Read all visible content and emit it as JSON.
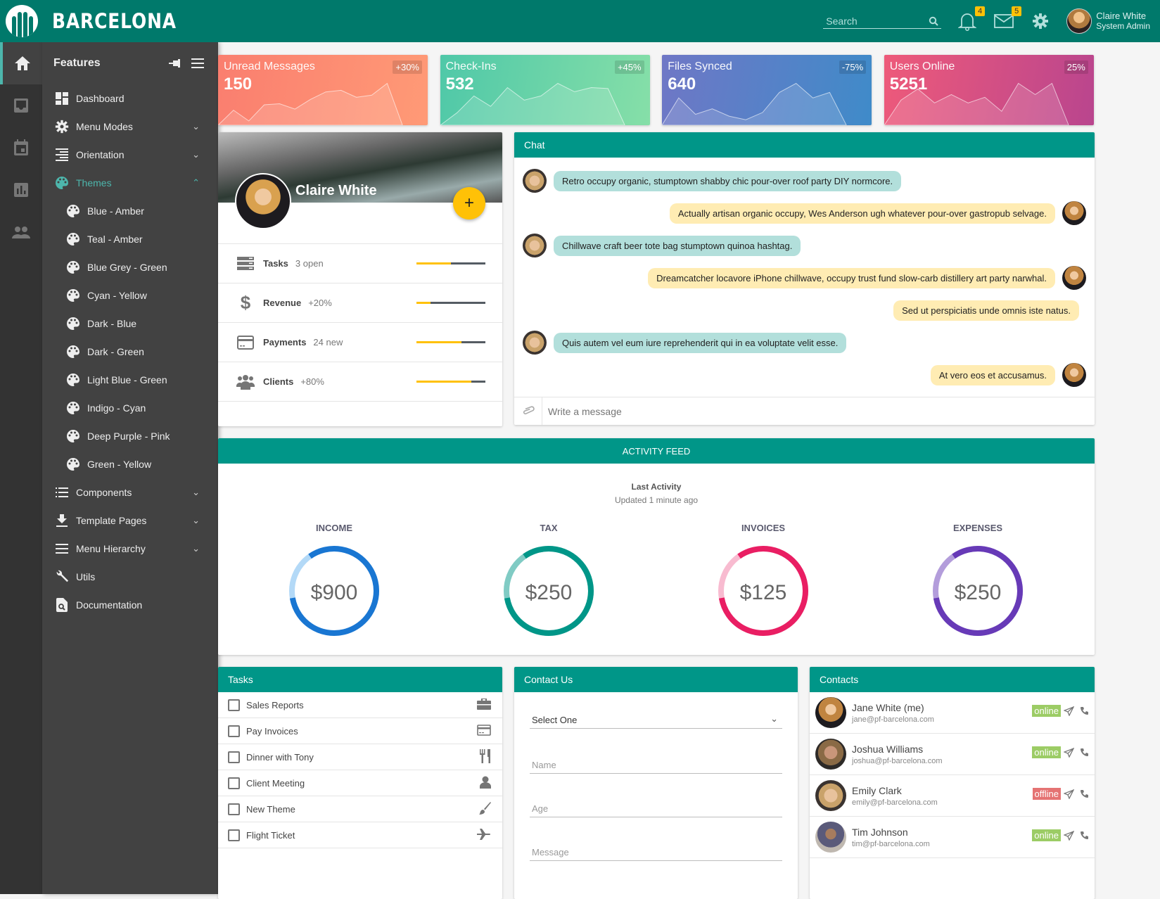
{
  "brand": {
    "name": "BARCELONA"
  },
  "topbar": {
    "search_placeholder": "Search",
    "notifications": {
      "icon": "bell-icon",
      "count": "4"
    },
    "messages": {
      "icon": "envelope-icon",
      "count": "5"
    },
    "settings_icon": "gear-icon",
    "user": {
      "name": "Claire White",
      "role": "System Admin"
    }
  },
  "rail": [
    "home-icon",
    "inbox-icon",
    "calendar-icon",
    "chart-icon",
    "people-icon"
  ],
  "menu": {
    "title": "Features",
    "items": [
      {
        "label": "Dashboard",
        "icon": "dashboard-icon",
        "expandable": false
      },
      {
        "label": "Menu Modes",
        "icon": "gear-icon",
        "expandable": true
      },
      {
        "label": "Orientation",
        "icon": "align-right-icon",
        "expandable": true
      },
      {
        "label": "Themes",
        "icon": "palette-icon",
        "expandable": true,
        "expanded": true,
        "active": true
      },
      {
        "label": "Blue - Amber",
        "icon": "palette-icon",
        "sub": true
      },
      {
        "label": "Teal - Amber",
        "icon": "palette-icon",
        "sub": true
      },
      {
        "label": "Blue Grey - Green",
        "icon": "palette-icon",
        "sub": true
      },
      {
        "label": "Cyan - Yellow",
        "icon": "palette-icon",
        "sub": true
      },
      {
        "label": "Dark - Blue",
        "icon": "palette-icon",
        "sub": true
      },
      {
        "label": "Dark - Green",
        "icon": "palette-icon",
        "sub": true
      },
      {
        "label": "Light Blue - Green",
        "icon": "palette-icon",
        "sub": true
      },
      {
        "label": "Indigo - Cyan",
        "icon": "palette-icon",
        "sub": true
      },
      {
        "label": "Deep Purple - Pink",
        "icon": "palette-icon",
        "sub": true
      },
      {
        "label": "Green - Yellow",
        "icon": "palette-icon",
        "sub": true
      },
      {
        "label": "Components",
        "icon": "list-icon",
        "expandable": true
      },
      {
        "label": "Template Pages",
        "icon": "download-icon",
        "expandable": true
      },
      {
        "label": "Menu Hierarchy",
        "icon": "menu-icon",
        "expandable": true
      },
      {
        "label": "Utils",
        "icon": "wrench-icon",
        "expandable": false
      },
      {
        "label": "Documentation",
        "icon": "document-search-icon",
        "expandable": false
      }
    ]
  },
  "kpis": [
    {
      "title": "Unread Messages",
      "value": "150",
      "change": "+30%",
      "colors": [
        "#fa7e6f",
        "#ff9a76"
      ],
      "spark": [
        0,
        28,
        8,
        38,
        40,
        30,
        48,
        62,
        65,
        52,
        56,
        78,
        0
      ]
    },
    {
      "title": "Check-Ins",
      "value": "532",
      "change": "+45%",
      "colors": [
        "#4fc8a8",
        "#86dfa8"
      ],
      "spark": [
        0,
        12,
        28,
        18,
        36,
        24,
        28,
        40,
        32,
        36,
        35,
        0
      ]
    },
    {
      "title": "Files Synced",
      "value": "640",
      "change": "-75%",
      "colors": [
        "#6f77c6",
        "#3f8bc9"
      ],
      "spark": [
        0,
        30,
        12,
        18,
        10,
        6,
        14,
        36,
        46,
        30,
        36,
        0
      ]
    },
    {
      "title": "Users Online",
      "value": "5251",
      "change": "25%",
      "colors": [
        "#ee5a7a",
        "#b9458e"
      ],
      "spark": [
        0,
        18,
        26,
        16,
        22,
        16,
        20,
        10,
        30,
        22,
        30,
        0
      ]
    }
  ],
  "profile": {
    "name": "Claire White",
    "fab_label": "+",
    "stats": [
      {
        "label": "Tasks",
        "sub": "3 open",
        "icon": "server-icon",
        "progress": 0.5
      },
      {
        "label": "Revenue",
        "sub": "+20%",
        "icon": "dollar-icon",
        "progress": 0.2
      },
      {
        "label": "Payments",
        "sub": "24 new",
        "icon": "credit-card-icon",
        "progress": 0.65
      },
      {
        "label": "Clients",
        "sub": "+80%",
        "icon": "users-icon",
        "progress": 0.8
      }
    ]
  },
  "chat": {
    "title": "Chat",
    "messages": [
      {
        "side": "left",
        "text": "Retro occupy organic, stumptown shabby chic pour-over roof party DIY normcore."
      },
      {
        "side": "right",
        "text": "Actually artisan organic occupy, Wes Anderson ugh whatever pour-over gastropub selvage."
      },
      {
        "side": "left",
        "text": "Chillwave craft beer tote bag stumptown quinoa hashtag."
      },
      {
        "side": "right",
        "text": "Dreamcatcher locavore iPhone chillwave, occupy trust fund slow-carb distillery art party narwhal."
      },
      {
        "side": "right-noavatar",
        "text": "Sed ut perspiciatis unde omnis iste natus."
      },
      {
        "side": "left",
        "text": "Quis autem vel eum iure reprehenderit qui in ea voluptate velit esse."
      },
      {
        "side": "right",
        "text": "At vero eos et accusamus."
      }
    ],
    "input_placeholder": "Write a message"
  },
  "activity": {
    "title": "ACTIVITY FEED",
    "subtitle": "Last Activity",
    "updated": "Updated 1 minute ago",
    "rings": [
      {
        "label": "INCOME",
        "value": "$900",
        "fraction": 0.82,
        "color": "#1976d2",
        "track": "#b3d9f7"
      },
      {
        "label": "TAX",
        "value": "$250",
        "fraction": 0.82,
        "color": "#009688",
        "track": "#80cbc4"
      },
      {
        "label": "INVOICES",
        "value": "$125",
        "fraction": 0.82,
        "color": "#e91e63",
        "track": "#f8bbd0"
      },
      {
        "label": "EXPENSES",
        "value": "$250",
        "fraction": 0.82,
        "color": "#673ab7",
        "track": "#b39ddb"
      }
    ]
  },
  "tasks": {
    "title": "Tasks",
    "items": [
      {
        "label": "Sales Reports",
        "icon": "briefcase-icon",
        "checked": false
      },
      {
        "label": "Pay Invoices",
        "icon": "credit-card-icon",
        "checked": false
      },
      {
        "label": "Dinner with Tony",
        "icon": "cutlery-icon",
        "checked": false
      },
      {
        "label": "Client Meeting",
        "icon": "user-icon",
        "checked": false
      },
      {
        "label": "New Theme",
        "icon": "paint-brush-icon",
        "checked": false
      },
      {
        "label": "Flight Ticket",
        "icon": "plane-icon",
        "checked": false
      }
    ]
  },
  "contact_form": {
    "title": "Contact Us",
    "select_value": "Select One",
    "name_placeholder": "Name",
    "age_placeholder": "Age",
    "message_placeholder": "Message"
  },
  "contacts": {
    "title": "Contacts",
    "items": [
      {
        "name": "Jane White (me)",
        "email": "jane@pf-barcelona.com",
        "status": "online"
      },
      {
        "name": "Joshua Williams",
        "email": "joshua@pf-barcelona.com",
        "status": "online"
      },
      {
        "name": "Emily Clark",
        "email": "emily@pf-barcelona.com",
        "status": "offline"
      },
      {
        "name": "Tim Johnson",
        "email": "tim@pf-barcelona.com",
        "status": "online"
      }
    ],
    "status_colors": {
      "online": "#9ccc65",
      "offline": "#e57373"
    }
  }
}
